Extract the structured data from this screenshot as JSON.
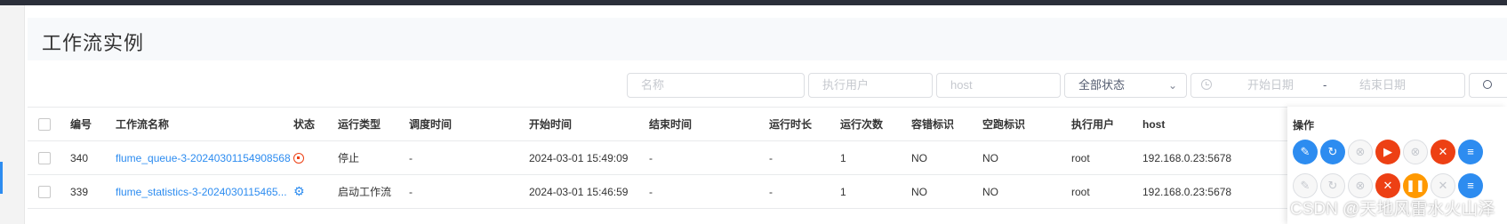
{
  "page": {
    "title": "工作流实例"
  },
  "filters": {
    "name_placeholder": "名称",
    "executor_placeholder": "执行用户",
    "host_placeholder": "host",
    "status_value": "全部状态",
    "start_date_placeholder": "开始日期",
    "date_separator": "-",
    "end_date_placeholder": "结束日期"
  },
  "table": {
    "columns": {
      "id": "编号",
      "name": "工作流名称",
      "state": "状态",
      "run_type": "运行类型",
      "schedule_time": "调度时间",
      "start_time": "开始时间",
      "end_time": "结束时间",
      "duration": "运行时长",
      "run_times": "运行次数",
      "fault_tolerant": "容错标识",
      "dry_run": "空跑标识",
      "executor": "执行用户",
      "host": "host",
      "operation": "操作"
    },
    "rows": [
      {
        "id": "340",
        "name": "flume_queue-3-20240301154908568",
        "state_icon": "stop-circle-icon",
        "run_type": "停止",
        "schedule_time": "-",
        "start_time": "2024-03-01 15:49:09",
        "end_time": "-",
        "duration": "-",
        "run_times": "1",
        "fault_tolerant": "NO",
        "dry_run": "NO",
        "executor": "root",
        "host": "192.168.0.23:5678"
      },
      {
        "id": "339",
        "name": "flume_statistics-3-2024030115465...",
        "state_icon": "gear-icon",
        "run_type": "启动工作流",
        "schedule_time": "-",
        "start_time": "2024-03-01 15:46:59",
        "end_time": "-",
        "duration": "-",
        "run_times": "1",
        "fault_tolerant": "NO",
        "dry_run": "NO",
        "executor": "root",
        "host": "192.168.0.23:5678"
      }
    ]
  },
  "actions": {
    "row1": [
      "edit-icon",
      "rerun-icon",
      "recover-failed-icon",
      "execute-icon",
      "pause-icon",
      "delete-icon",
      "gantt-icon"
    ],
    "row2": [
      "edit-icon",
      "rerun-icon",
      "recover-failed-icon",
      "stop-icon",
      "pause-icon",
      "delete-icon",
      "gantt-icon"
    ]
  },
  "colors": {
    "primary": "#2d8cf0",
    "danger": "#ed4014",
    "warning": "#ff9900"
  },
  "watermark": "CSDN @天地风雷水火山泽"
}
